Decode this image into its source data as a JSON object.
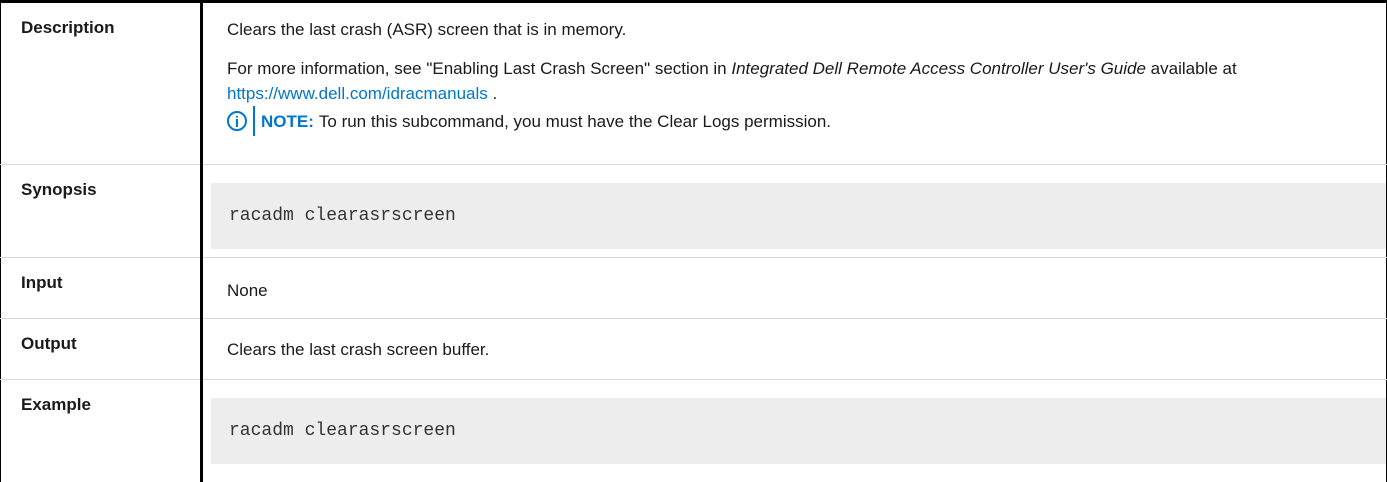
{
  "rows": {
    "description": {
      "label": "Description",
      "line1": "Clears the last crash (ASR) screen that is in memory.",
      "more_info_prefix": "For more information, see \"Enabling Last Crash Screen\" section in ",
      "guide_title": "Integrated Dell Remote Access Controller User's Guide",
      "available_at": " available at ",
      "link_text": "https://www.dell.com/idracmanuals",
      "suffix": " .",
      "note_label": "NOTE:",
      "note_text": "To run this subcommand, you must have the Clear Logs permission.",
      "note_icon": "info-icon"
    },
    "synopsis": {
      "label": "Synopsis",
      "code": "racadm clearasrscreen"
    },
    "input": {
      "label": "Input",
      "text": "None"
    },
    "output": {
      "label": "Output",
      "text": "Clears the last crash screen buffer."
    },
    "example": {
      "label": "Example",
      "code": "racadm clearasrscreen"
    }
  },
  "colors": {
    "accent": "#0076ce",
    "code_bg": "#ededed",
    "border": "#000000"
  }
}
